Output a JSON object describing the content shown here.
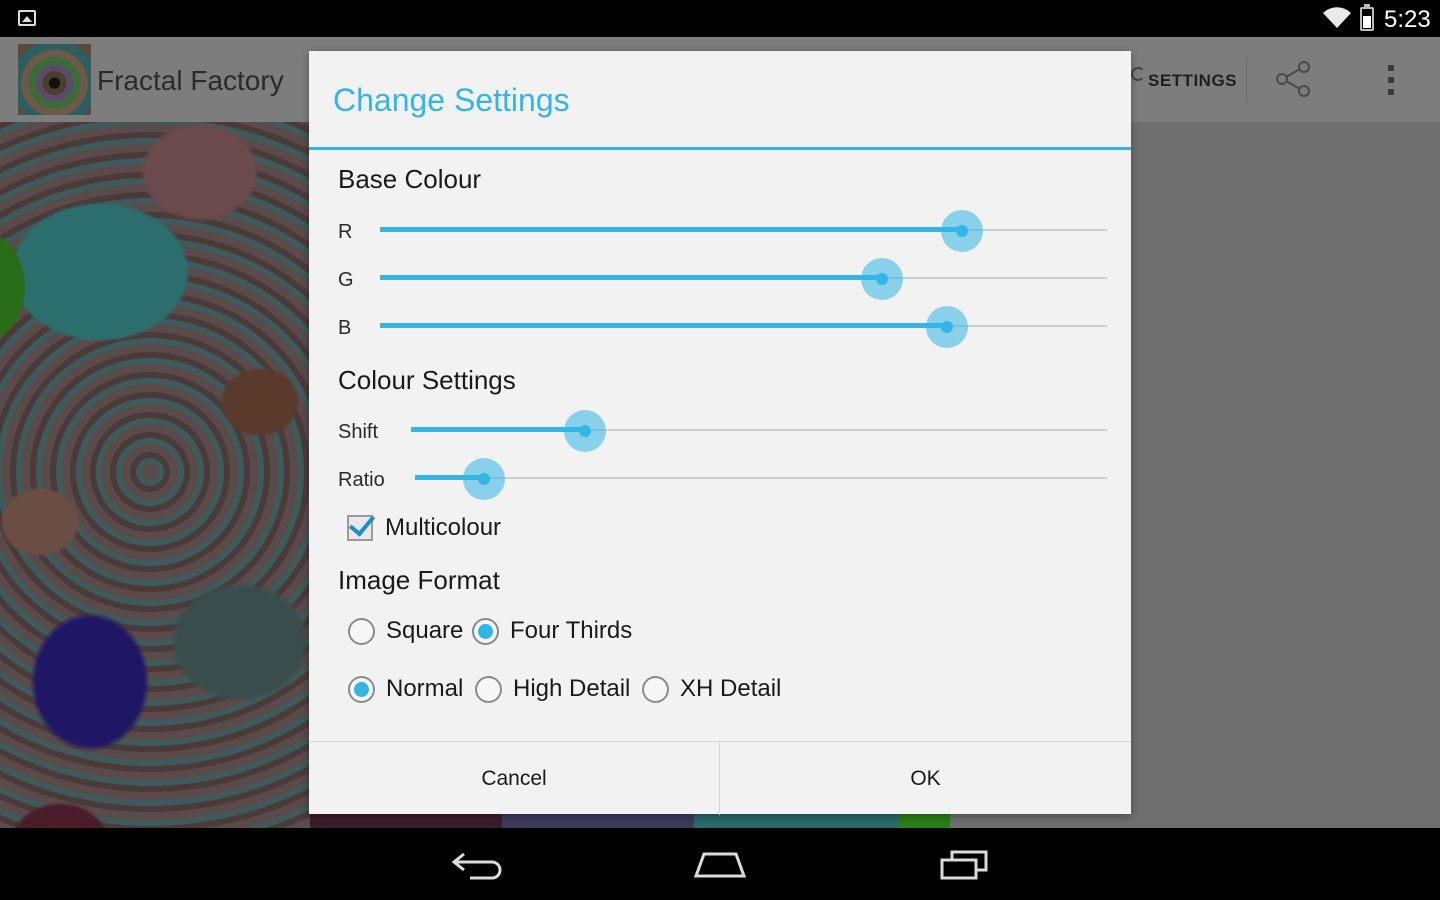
{
  "status_bar": {
    "time": "5:23",
    "icons": [
      "gallery-notification-icon",
      "wifi-icon",
      "battery-icon"
    ]
  },
  "action_bar": {
    "title": "Fractal Factory",
    "settings_label": "SETTINGS",
    "icons": [
      "app-icon",
      "share-icon",
      "overflow-menu-icon"
    ]
  },
  "dialog": {
    "title": "Change Settings",
    "base_colour": {
      "heading": "Base Colour",
      "r_label": "R",
      "g_label": "G",
      "b_label": "B",
      "r_value": 0.8,
      "g_value": 0.69,
      "b_value": 0.78
    },
    "colour_settings": {
      "heading": "Colour Settings",
      "shift_label": "Shift",
      "ratio_label": "Ratio",
      "shift_value": 0.25,
      "ratio_value": 0.1,
      "multicolour_label": "Multicolour",
      "multicolour_checked": true
    },
    "image_format": {
      "heading": "Image Format",
      "square_label": "Square",
      "four_thirds_label": "Four Thirds",
      "aspect_selected": "Four Thirds",
      "normal_label": "Normal",
      "high_detail_label": "High Detail",
      "xh_detail_label": "XH Detail",
      "detail_selected": "Normal"
    },
    "buttons": {
      "cancel": "Cancel",
      "ok": "OK"
    }
  },
  "navigation_bar": {
    "icons": [
      "back-icon",
      "home-icon",
      "recents-icon"
    ]
  },
  "colors": {
    "accent": "#33b5e5",
    "dialog_background": "#f2f2f2",
    "dim_overlay": "#6f6f6f"
  }
}
